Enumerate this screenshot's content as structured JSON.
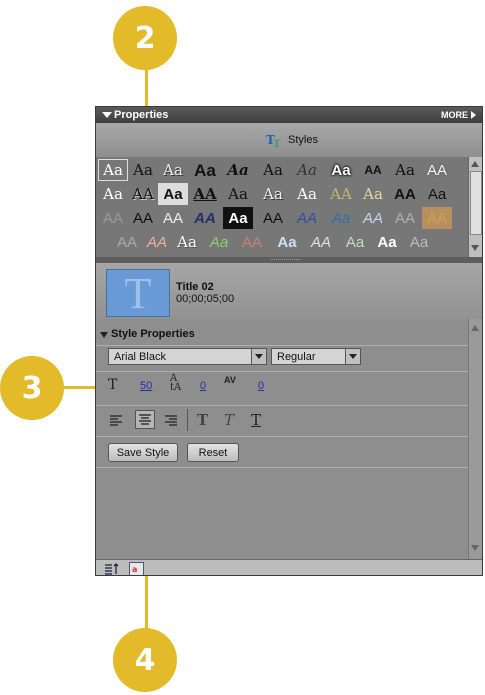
{
  "callouts": [
    "2",
    "3",
    "4"
  ],
  "panel": {
    "title": "Properties",
    "more_label": "MORE",
    "styles_label": "Styles"
  },
  "gallery": {
    "rows": [
      [
        "Aa",
        "Aa",
        "Aa",
        "Aa",
        "Aa",
        "Aa",
        "Aa",
        "Aa",
        "AA",
        "Aa",
        "AA"
      ],
      [
        "Aa",
        "AA",
        "Aa",
        "AA",
        "Aa",
        "Aa",
        "Aa",
        "AA",
        "Aa",
        "AA",
        "Aa"
      ],
      [
        "AA",
        "AA",
        "AA",
        "AA",
        "Aa",
        "AA",
        "AA",
        "Aa",
        "AA",
        "AA",
        "AA"
      ],
      [
        "AA",
        "AA",
        "Aa",
        "Aa",
        "AA",
        "Aa",
        "AA",
        "Aa",
        "Aa",
        "Aa"
      ]
    ]
  },
  "clip": {
    "name": "Title 02",
    "timecode": "00;00;05;00",
    "thumb_glyph": "T"
  },
  "style_properties": {
    "header": "Style Properties",
    "font": "Arial Black",
    "weight": "Regular",
    "size": "50",
    "leading": "0",
    "kerning": "0",
    "save_label": "Save Style",
    "reset_label": "Reset"
  },
  "colors": {
    "callout": "#e3bb2a",
    "panel_bg": "#8d8d8d"
  }
}
